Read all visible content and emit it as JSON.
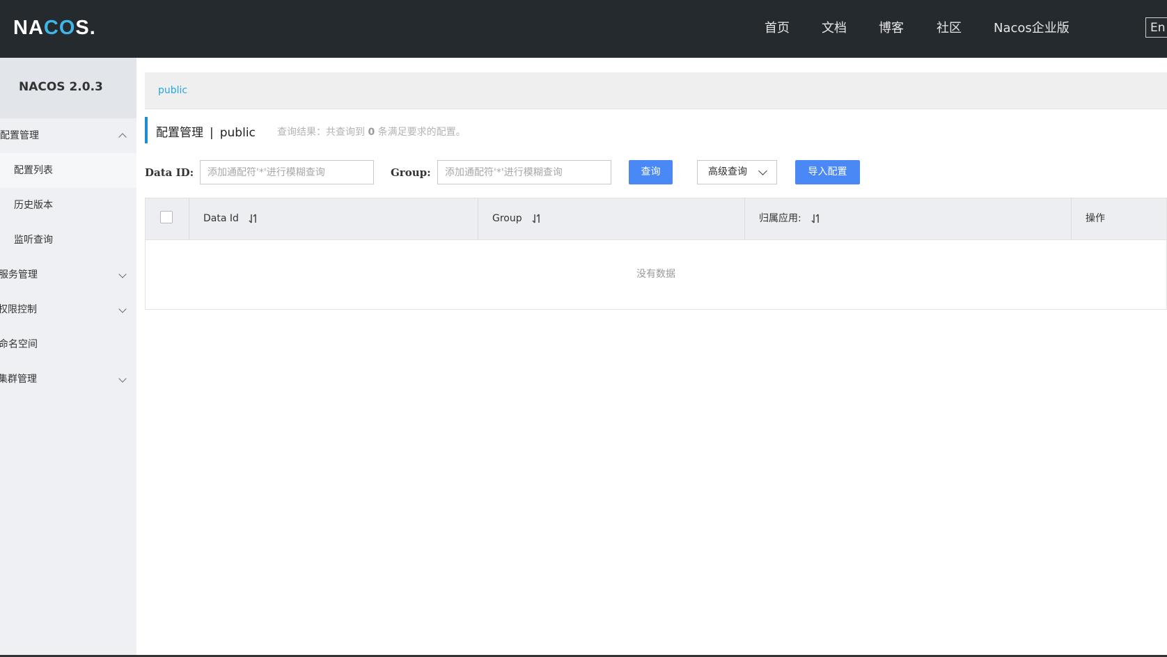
{
  "header": {
    "logo": {
      "na": "NA",
      "co": "CO",
      "s": "S."
    },
    "nav": [
      "首页",
      "文档",
      "博客",
      "社区",
      "Nacos企业版"
    ],
    "lang": "En"
  },
  "sidebar": {
    "title": "NACOS 2.0.3",
    "items": [
      {
        "label": "配置管理",
        "expanded": true
      },
      {
        "label": "配置列表",
        "sub": true,
        "active": true
      },
      {
        "label": "历史版本",
        "sub": true
      },
      {
        "label": "监听查询",
        "sub": true
      },
      {
        "label": "服务管理",
        "expanded": false
      },
      {
        "label": "权限控制",
        "expanded": false
      },
      {
        "label": "命名空间"
      },
      {
        "label": "集群管理",
        "expanded": false
      }
    ]
  },
  "breadcrumb": "public",
  "page": {
    "title": "配置管理",
    "separator": "|",
    "namespace": "public",
    "result_prefix": "查询结果：共查询到",
    "result_count": "0",
    "result_suffix": "条满足要求的配置。"
  },
  "search": {
    "data_id_label": "Data ID:",
    "data_id_placeholder": "添加通配符'*'进行模糊查询",
    "group_label": "Group:",
    "group_placeholder": "添加通配符'*'进行模糊查询",
    "query_button": "查询",
    "advanced_button": "高级查询",
    "import_button": "导入配置"
  },
  "table": {
    "columns": [
      "Data Id",
      "Group",
      "归属应用:",
      "操作"
    ],
    "empty_text": "没有数据"
  }
}
